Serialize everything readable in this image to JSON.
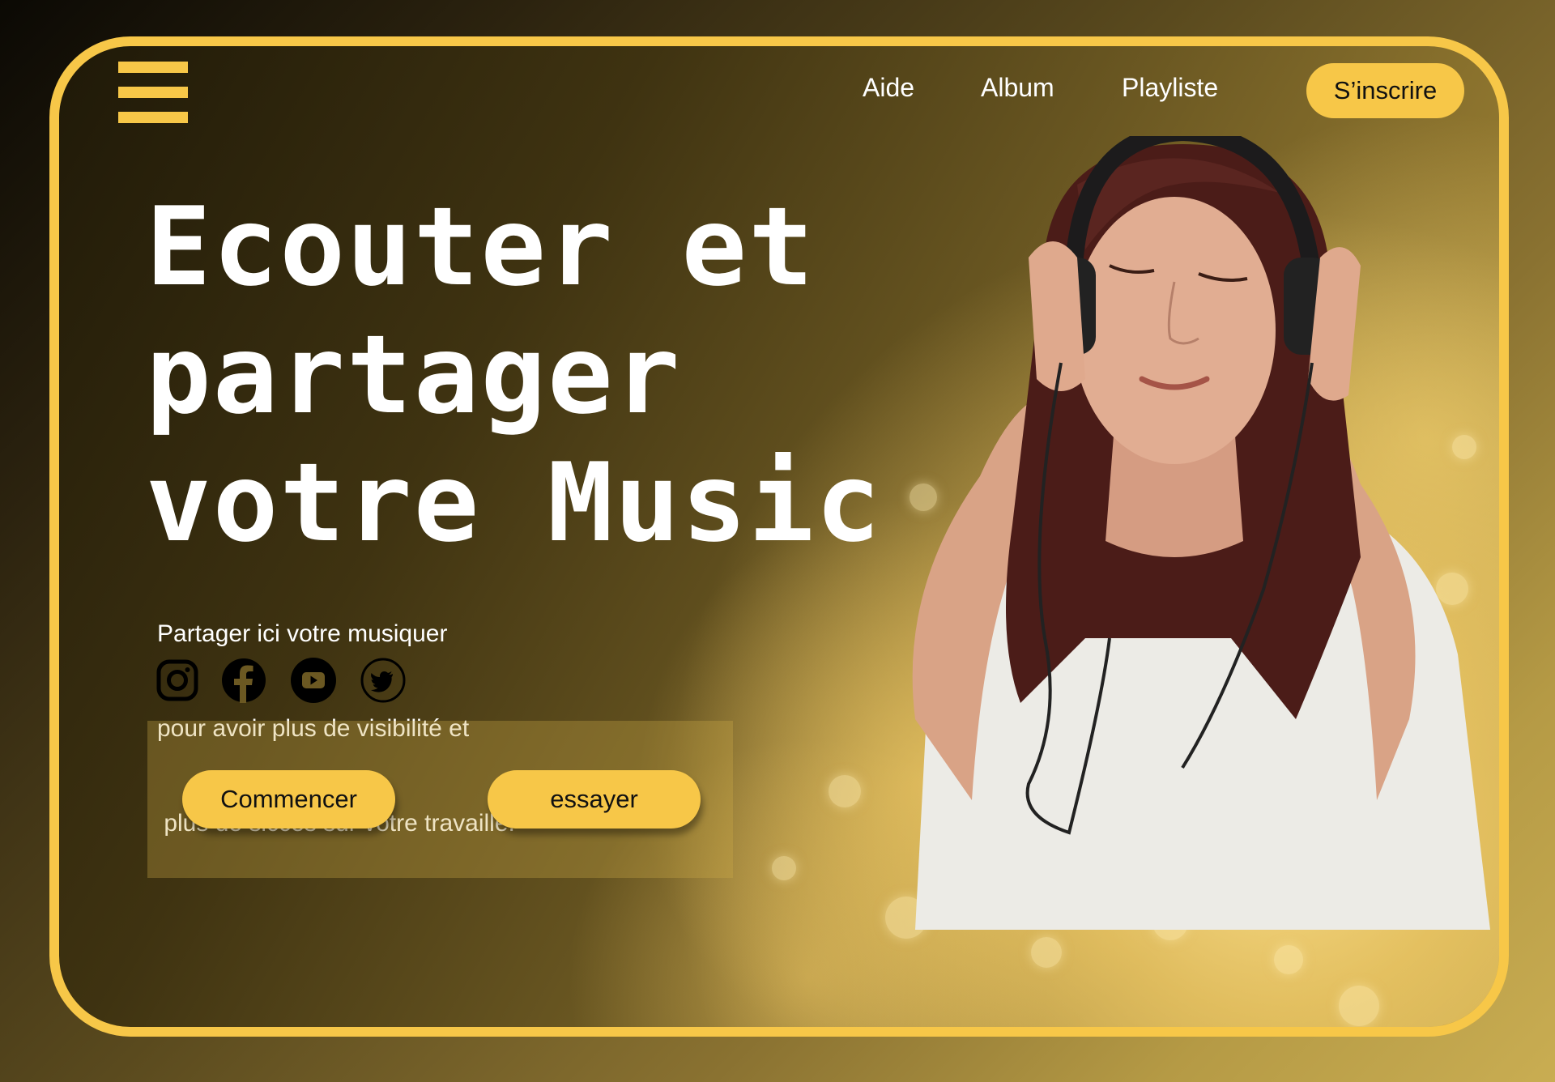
{
  "nav": {
    "items": [
      "Aide",
      "Album",
      "Playliste"
    ],
    "signup_label": "S’inscrire"
  },
  "hero": {
    "headline": [
      "Ecouter et",
      "partager",
      "votre Music"
    ],
    "subtext": [
      "Partager ici votre musiquer",
      "pour avoir plus de visibilité et",
      " plus de siccès sur votre travaille."
    ]
  },
  "social": [
    "instagram-icon",
    "facebook-icon",
    "youtube-icon",
    "twitter-icon"
  ],
  "cta": {
    "primary_label": "Commencer",
    "secondary_label": "essayer"
  },
  "colors": {
    "accent": "#f7c748",
    "text": "#ffffff",
    "dark": "#111111"
  }
}
